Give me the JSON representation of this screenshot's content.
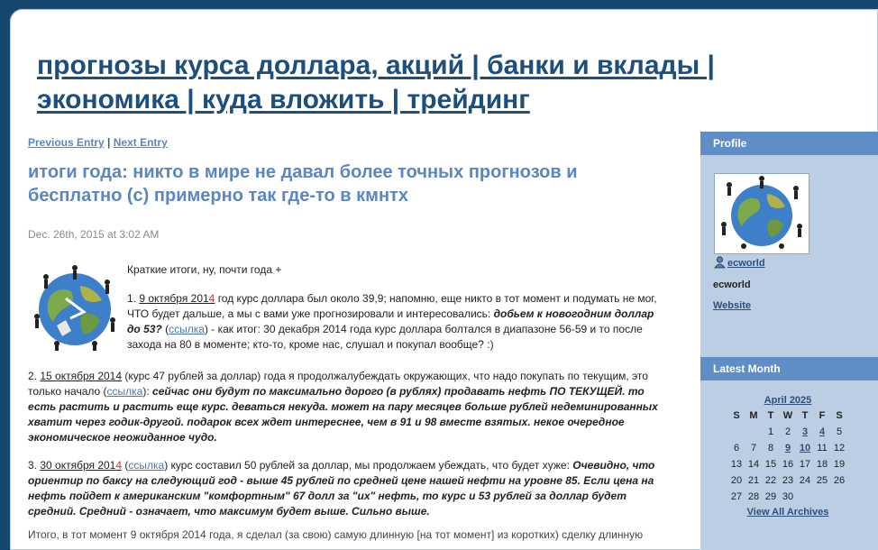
{
  "blog": {
    "title": "прогнозы курса доллара, акций | банки и вклады | экономика | куда вложить | трейдинг"
  },
  "nav": {
    "previous": "Previous Entry",
    "separator": "|",
    "next": "Next Entry"
  },
  "entry": {
    "title": "итоги года: никто в мире не давал более точных прогнозов и бесплатно (с) примерно так где-то в кмнтх",
    "date": "Dec. 26th, 2015 at 3:02 AM",
    "intro": "Краткие итоги, ну, почти года +",
    "p1": {
      "num": "1. ",
      "date_a": "9 октября 201",
      "date_b": "4",
      "text1": " год курс доллара был около 39,9; напомню, еще никто в тот момент и подумать не мог, ЧТО будет дальше, а мы с вами уже прогнозировали и интересовались: ",
      "em1": "добьем к новогодним доллар до 53?",
      "paren_open": " (",
      "link": "ссылка",
      "text2": ") -  как итог: 30 декабря 2014 года курс доллара болтался в диапазоне 56-59 и то после захода на 80 в моменте; кто-то, кроме нас, слушал и покупал вообще? :)"
    },
    "p2": {
      "num": "2. ",
      "date": "15 октября 2014",
      "text1": " (курс 47 рублей за доллар) года я продолжалубеждать окружающих, что надо покупать по текущим, это только начало (",
      "link": "ссылка",
      "text2": "): ",
      "em1": "сейчас они будут по максимально дорого (в рублях) продавать нефть ПО ТЕКУЩЕЙ. то есть растить и растить еще курс. деваться некуда. может на пару месяцев больше рублей недеминированных хватит через годик-другой. подарок всех ждет интереснее, чем в 91 и 98 вместе взятых. некое очередное экономическое неожиданное чудо."
    },
    "p3": {
      "num": "3. ",
      "date_a": "30 октября 201",
      "date_b": "4",
      "paren_open": " (",
      "link": "ссылка",
      "text1": ") курс составил 50 рублей за доллар, мы продолжаем убеждать, что будет хуже: ",
      "em1": "Очевидно, что ориентир по баксу на следующий год - выше 45 рублей по средней цене нашей нефти на уровне 85. Если цена на нефть пойдет к американским \"комфортным\" 67 долл за \"их\" нефть, то курс и 53 рублей за доллар будет средний. Средний - означает, что максимум будет выше. Сильно выше."
    },
    "p4": {
      "text": "Итого, в тот момент 9 октября 2014 года, я сделал (за свою) самую длинную [на тот момент] из коротких) сделку длинную"
    }
  },
  "sidebar": {
    "profile_header": "Profile",
    "username_link": "ecworld",
    "username": "ecworld",
    "website_link": "Website",
    "latest_header": "Latest Month",
    "calendar": {
      "month": "April 2025",
      "weekdays": [
        "S",
        "M",
        "T",
        "W",
        "T",
        "F",
        "S"
      ],
      "weeks": [
        [
          "",
          "",
          "1",
          "2",
          "3",
          "4",
          "5"
        ],
        [
          "6",
          "7",
          "8",
          "9",
          "10",
          "11",
          "12"
        ],
        [
          "13",
          "14",
          "15",
          "16",
          "17",
          "18",
          "19"
        ],
        [
          "20",
          "21",
          "22",
          "23",
          "24",
          "25",
          "26"
        ],
        [
          "27",
          "28",
          "29",
          "30",
          "",
          "",
          ""
        ]
      ],
      "linked_days": [
        "3",
        "4",
        "9",
        "10"
      ],
      "archives_link": "View All Archives"
    }
  },
  "colors": {
    "background": "#16476e",
    "title": "#1c4e7e",
    "accent": "#5b86c0",
    "sidebar": "#bccee3",
    "sidebar_header": "#5f8ec6",
    "date_red": "#d2302b"
  },
  "icons": {
    "entry_image": "globe-dancers-icon",
    "profile_image": "globe-dancers-icon",
    "user": "user-icon"
  }
}
